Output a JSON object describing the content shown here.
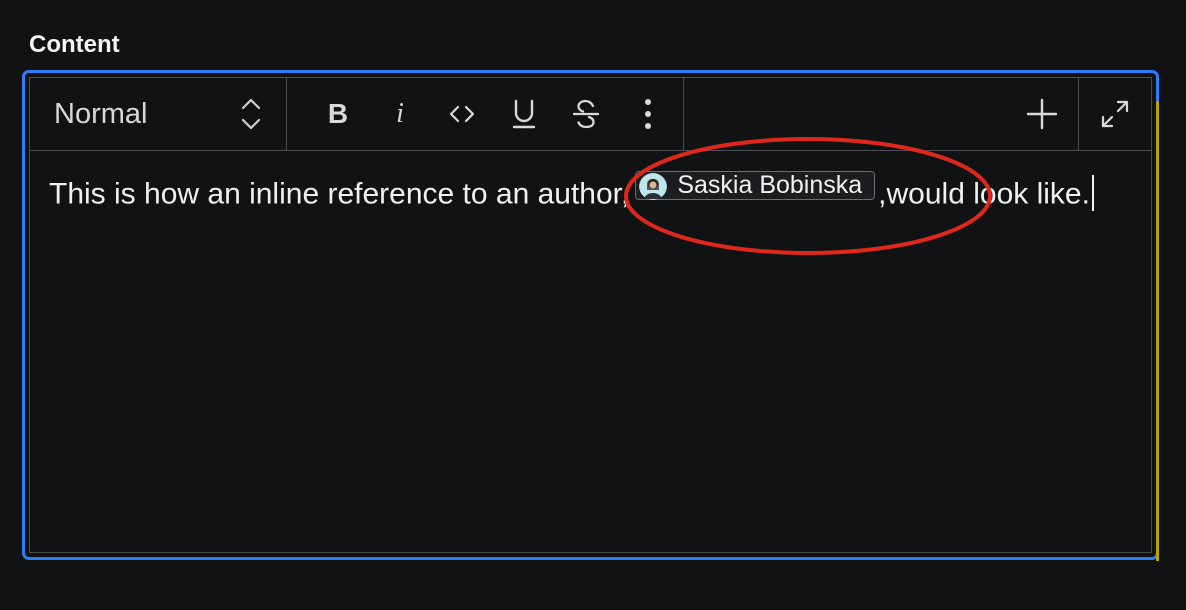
{
  "field": {
    "label": "Content"
  },
  "toolbar": {
    "style_value": "Normal",
    "bold_label": "B",
    "italic_label": "i",
    "icons": [
      "updown-chevrons-icon",
      "code-icon",
      "underline-icon",
      "strikethrough-icon",
      "more-vertical-icon",
      "plus-icon",
      "expand-icon"
    ]
  },
  "content": {
    "text_before": "This is how an inline reference to an author,",
    "mention": {
      "name": "Saskia Bobinska",
      "avatar_icon": "user-avatar"
    },
    "text_after": ",would look like."
  },
  "colors": {
    "focus_border": "#2f7cf6",
    "annotation": "#e0271c",
    "background": "#111214"
  }
}
